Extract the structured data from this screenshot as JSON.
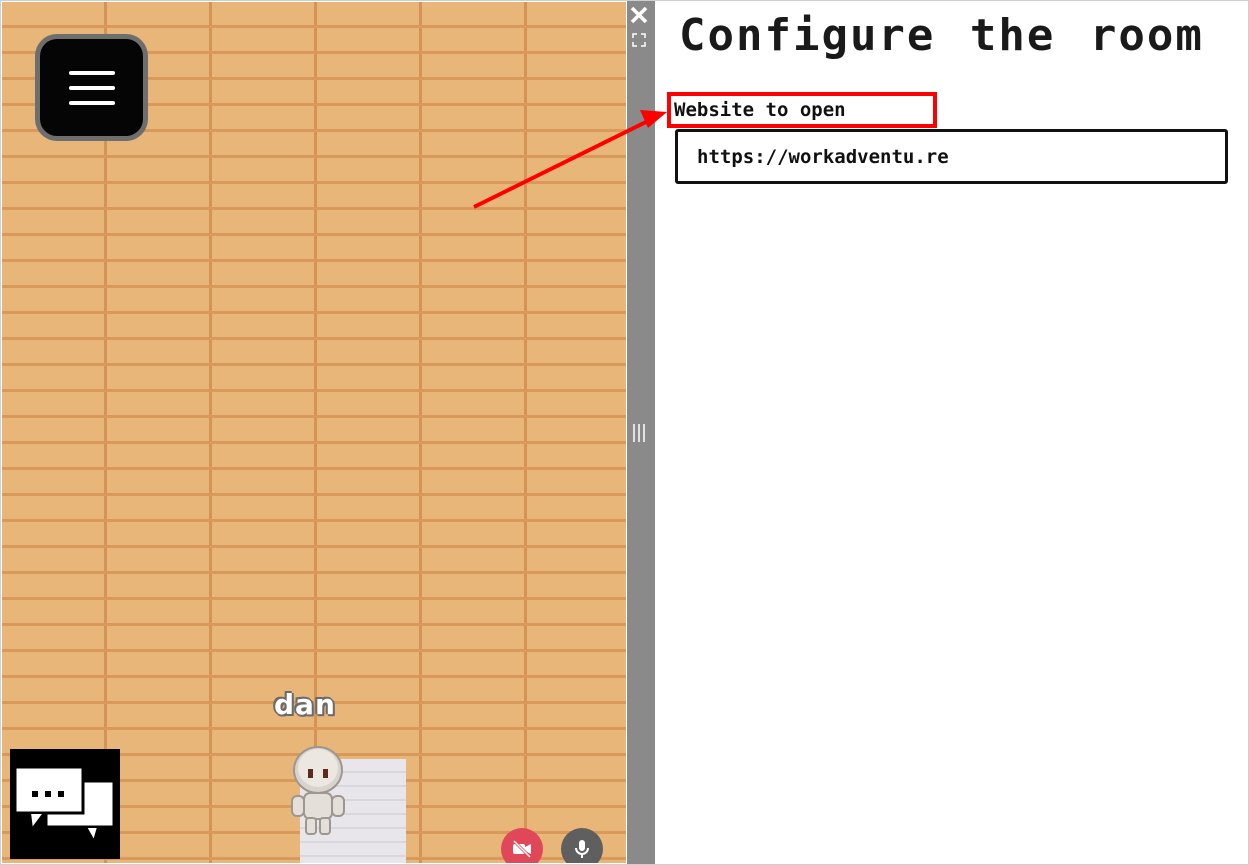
{
  "game": {
    "player_name": "dan"
  },
  "panel": {
    "title": "Configure the room",
    "website_label": "Website to open",
    "website_value": "https://workadventu.re"
  },
  "icons": {
    "menu": "hamburger-menu-icon",
    "chat": "chat-bubbles-icon",
    "camera": "camera-off-icon",
    "mic": "microphone-icon",
    "close": "close-icon",
    "fullscreen": "fullscreen-icon",
    "resize": "resize-handle-icon"
  },
  "colors": {
    "annotation": "#ff0000",
    "floor": "#e9b67a",
    "camera_off": "#e0485a",
    "divider": "#8a8a8a"
  }
}
